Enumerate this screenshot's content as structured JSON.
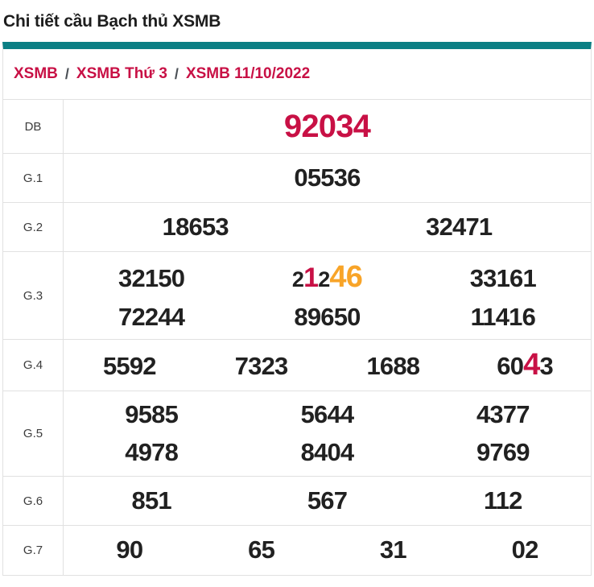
{
  "title": "Chi tiết cầu Bạch thủ XSMB",
  "colors": {
    "accent_teal": "#0b7f84",
    "crimson": "#c81045",
    "orange": "#f8a428",
    "grid": "#e1e1e1"
  },
  "breadcrumb": {
    "separator": "/",
    "items": [
      {
        "label": "XSMB"
      },
      {
        "label": "XSMB Thứ 3"
      },
      {
        "label": "XSMB 11/10/2022"
      }
    ]
  },
  "table": {
    "rows": [
      {
        "label": "DB",
        "lines": [
          [
            [
              {
                "text": "92034",
                "color": "crimson",
                "size": "db"
              }
            ]
          ]
        ]
      },
      {
        "label": "G.1",
        "lines": [
          [
            [
              {
                "text": "05536"
              }
            ]
          ]
        ]
      },
      {
        "label": "G.2",
        "lines": [
          [
            [
              {
                "text": "18653"
              }
            ],
            [
              {
                "text": "32471"
              }
            ]
          ]
        ]
      },
      {
        "label": "G.3",
        "lines": [
          [
            [
              {
                "text": "32150"
              }
            ],
            [
              {
                "text": "2",
                "size": "sm"
              },
              {
                "text": "1",
                "color": "crimson",
                "size": "hl"
              },
              {
                "text": "2",
                "size": "sm"
              },
              {
                "text": "46",
                "color": "orange",
                "size": "hl2"
              }
            ],
            [
              {
                "text": "33161"
              }
            ]
          ],
          [
            [
              {
                "text": "72244"
              }
            ],
            [
              {
                "text": "89650"
              }
            ],
            [
              {
                "text": "11416"
              }
            ]
          ]
        ]
      },
      {
        "label": "G.4",
        "lines": [
          [
            [
              {
                "text": "5592"
              }
            ],
            [
              {
                "text": "7323"
              }
            ],
            [
              {
                "text": "1688"
              }
            ],
            [
              {
                "text": "60"
              },
              {
                "text": "4",
                "color": "crimson",
                "size": "hl2"
              },
              {
                "text": "3"
              }
            ]
          ]
        ]
      },
      {
        "label": "G.5",
        "lines": [
          [
            [
              {
                "text": "9585"
              }
            ],
            [
              {
                "text": "5644"
              }
            ],
            [
              {
                "text": "4377"
              }
            ]
          ],
          [
            [
              {
                "text": "4978"
              }
            ],
            [
              {
                "text": "8404"
              }
            ],
            [
              {
                "text": "9769"
              }
            ]
          ]
        ]
      },
      {
        "label": "G.6",
        "lines": [
          [
            [
              {
                "text": "851"
              }
            ],
            [
              {
                "text": "567"
              }
            ],
            [
              {
                "text": "112"
              }
            ]
          ]
        ]
      },
      {
        "label": "G.7",
        "lines": [
          [
            [
              {
                "text": "90"
              }
            ],
            [
              {
                "text": "65"
              }
            ],
            [
              {
                "text": "31"
              }
            ],
            [
              {
                "text": "02"
              }
            ]
          ]
        ]
      }
    ]
  }
}
